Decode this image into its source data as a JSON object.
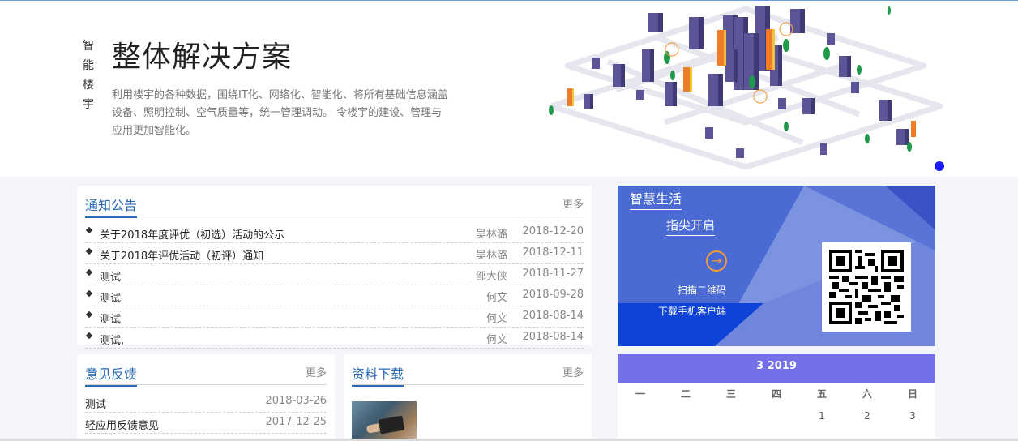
{
  "hero": {
    "side_chars": [
      "智",
      "能",
      "楼",
      "宇"
    ],
    "title": "整体解决方案",
    "description": "利用楼宇的各种数据，围绕IT化、网络化、智能化、将所有基础信息涵盖设备、照明控制、空气质量等，统一管理调动。 令楼宇的建设、管理与应用更加智能化。"
  },
  "notice": {
    "title": "通知公告",
    "more": "更多",
    "rows": [
      {
        "title": "关于2018年度评优（初选）活动的公示",
        "author": "吴林潞",
        "date": "2018-12-20"
      },
      {
        "title": "关于2018年评优活动（初评）通知",
        "author": "吴林潞",
        "date": "2018-12-11"
      },
      {
        "title": "测试",
        "author": "邹大侠",
        "date": "2018-11-27"
      },
      {
        "title": "测试",
        "author": "何文",
        "date": "2018-09-28"
      },
      {
        "title": "测试",
        "author": "何文",
        "date": "2018-08-14"
      },
      {
        "title": "测试,",
        "author": "何文",
        "date": "2018-08-14"
      }
    ]
  },
  "feedback": {
    "title": "意见反馈",
    "more": "更多",
    "rows": [
      {
        "title": "测试",
        "date": "2018-03-26"
      },
      {
        "title": "轻应用反馈意见",
        "date": "2017-12-25"
      }
    ]
  },
  "download": {
    "title": "资料下载",
    "more": "更多"
  },
  "smart": {
    "title": "智慧生活",
    "subtitle": "指尖开启",
    "arrow": "→",
    "scan": "扫描二维码",
    "download": "下载手机客户端",
    "colors": {
      "accent": "#f29c38",
      "base": "#4a6fd6"
    }
  },
  "calendar": {
    "header": "3  2019",
    "weekdays": [
      "一",
      "二",
      "三",
      "四",
      "五",
      "六",
      "日"
    ],
    "days": [
      "",
      "",
      "",
      "",
      "1",
      "2",
      "3"
    ],
    "colors": {
      "header": "#7470ea"
    }
  }
}
